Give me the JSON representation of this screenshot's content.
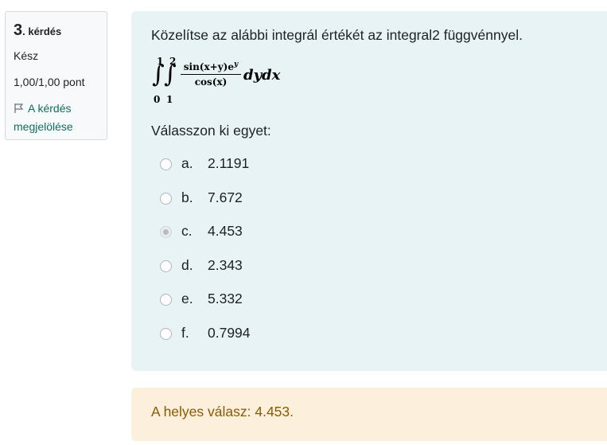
{
  "info": {
    "number": "3",
    "label": ". kérdés",
    "state": "Kész",
    "grade": "1,00/1,00 pont",
    "flag_label": "A kérdés megjelölése"
  },
  "question": {
    "text": "Közelítse az alábbi integrál értékét az integral2 függvénnyel.",
    "formula": {
      "outer_upper": "1",
      "outer_lower": "0",
      "inner_upper": "2",
      "inner_lower": "1",
      "numerator": "sin(x+y)e",
      "numerator_sup": "y",
      "denominator": "cos(x)",
      "differentials": "dydx"
    },
    "prompt": "Válasszon ki egyet:",
    "options": [
      {
        "letter": "a.",
        "value": "2.1191",
        "selected": false
      },
      {
        "letter": "b.",
        "value": "7.672",
        "selected": false
      },
      {
        "letter": "c.",
        "value": "4.453",
        "selected": true
      },
      {
        "letter": "d.",
        "value": "2.343",
        "selected": false
      },
      {
        "letter": "e.",
        "value": "5.332",
        "selected": false
      },
      {
        "letter": "f.",
        "value": "0.7994",
        "selected": false
      }
    ]
  },
  "feedback": {
    "text": "A helyes válasz: 4.453."
  },
  "colors": {
    "formulation_bg": "#e7f3f5",
    "feedback_bg": "#fcefdc",
    "feedback_text": "#8a5a00",
    "link": "#0f6e5f"
  }
}
